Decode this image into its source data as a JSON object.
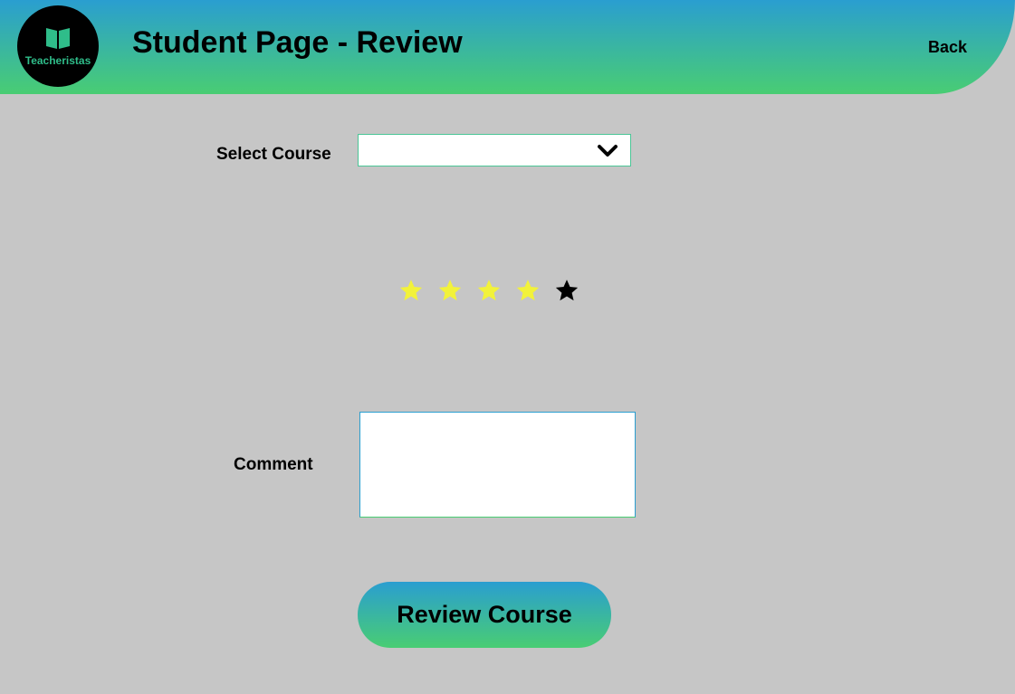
{
  "header": {
    "logo_text": "Teacheristas",
    "title": "Student Page - Review",
    "back_label": "Back"
  },
  "form": {
    "course_label": "Select Course",
    "course_value": "",
    "rating": {
      "value": 4,
      "max": 5
    },
    "comment_label": "Comment",
    "comment_value": "",
    "submit_label": "Review Course"
  },
  "colors": {
    "gradient_top": "#2a9ed0",
    "gradient_bottom": "#49cd73",
    "background": "#c6c6c6",
    "star_filled": "#f2f23a",
    "star_empty": "#000000"
  },
  "icons": {
    "logo": "open-book-icon",
    "dropdown": "chevron-down-icon",
    "rating": "star-icon"
  }
}
